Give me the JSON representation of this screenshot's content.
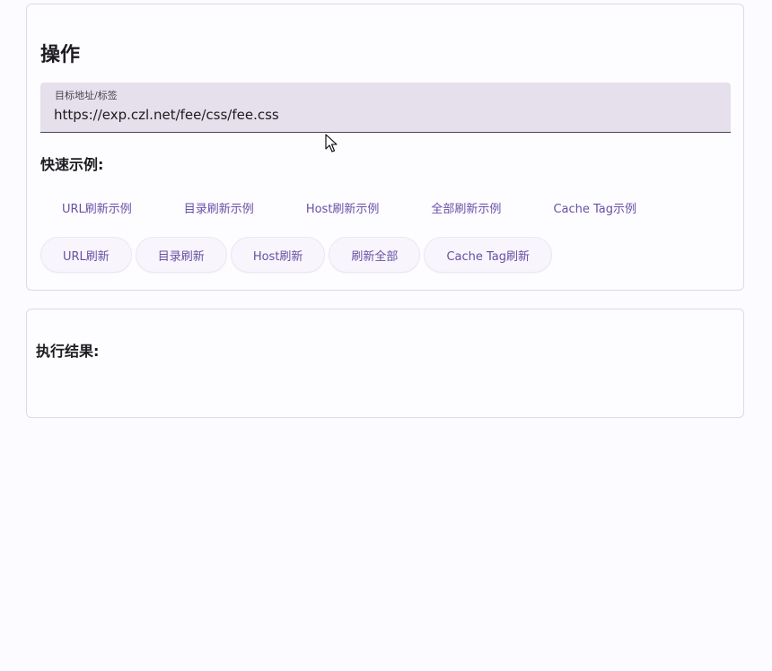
{
  "operations": {
    "title": "操作",
    "target_field": {
      "label": "目标地址/标签",
      "value": "https://exp.czl.net/fee/css/fee.css"
    },
    "quick_examples_title": "快速示例:",
    "examples": [
      {
        "label": "URL刷新示例"
      },
      {
        "label": "目录刷新示例"
      },
      {
        "label": "Host刷新示例"
      },
      {
        "label": "全部刷新示例"
      },
      {
        "label": "Cache Tag示例"
      }
    ],
    "actions": [
      {
        "label": "URL刷新"
      },
      {
        "label": "目录刷新"
      },
      {
        "label": "Host刷新"
      },
      {
        "label": "刷新全部"
      },
      {
        "label": "Cache Tag刷新"
      }
    ]
  },
  "result": {
    "title": "执行结果:",
    "content": ""
  },
  "colors": {
    "accent": "#6750a4",
    "field_bg": "#e6e0ec",
    "page_bg": "#fcfbff",
    "border": "#dddae6"
  },
  "icons": {
    "cursor": "mouse-pointer-icon"
  }
}
